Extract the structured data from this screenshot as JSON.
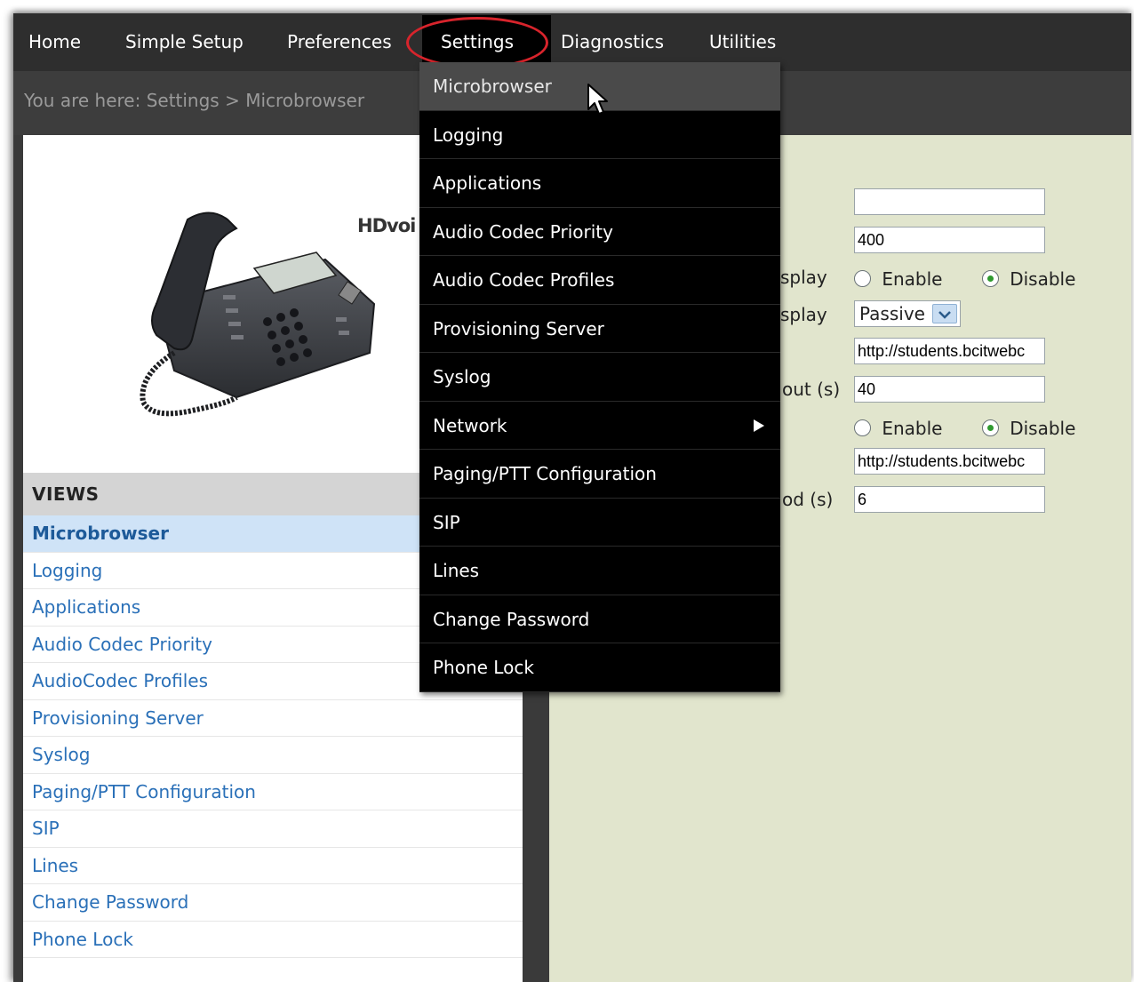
{
  "nav": {
    "items": [
      "Home",
      "Simple Setup",
      "Preferences",
      "Settings",
      "Diagnostics",
      "Utilities"
    ],
    "active": "Settings"
  },
  "breadcrumb": "You are here: Settings > Microbrowser",
  "product_logo": "HDvoi",
  "views": {
    "title": "VIEWS",
    "items": [
      "Microbrowser",
      "Logging",
      "Applications",
      "Audio Codec Priority",
      "AudioCodec Profiles",
      "Provisioning Server",
      "Syslog",
      "Paging/PTT Configuration",
      "SIP",
      "Lines",
      "Change Password",
      "Phone Lock"
    ],
    "active": "Microbrowser"
  },
  "dropdown": {
    "items": [
      "Microbrowser",
      "Logging",
      "Applications",
      "Audio Codec Priority",
      "Audio Codec Profiles",
      "Provisioning Server",
      "Syslog",
      "Network",
      "Paging/PTT Configuration",
      "SIP",
      "Lines",
      "Change Password",
      "Phone Lock"
    ],
    "highlighted": "Microbrowser",
    "has_submenu": "Network"
  },
  "form": {
    "field1_value": "",
    "field2_value": "400",
    "row3_label": "splay",
    "row3_enable": "Enable",
    "row3_disable": "Disable",
    "row4_label": "splay",
    "row4_select": "Passive",
    "field5_value": "http://students.bcitwebc",
    "row6_label": "out (s)",
    "field6_value": "40",
    "row7_enable": "Enable",
    "row7_disable": "Disable",
    "field8_value": "http://students.bcitwebc",
    "row9_label": "od (s)",
    "field9_value": "6"
  },
  "colors": {
    "accent_circle": "#d8242c",
    "link": "#2a70b8",
    "right_panel": "#e1e5cd"
  }
}
